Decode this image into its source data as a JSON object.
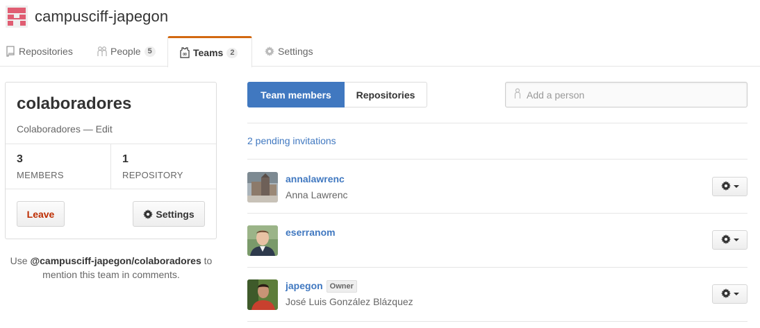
{
  "org": {
    "name": "campusciff-japegon",
    "avatar_icon": "identicon",
    "avatar_color": "#e05d72"
  },
  "tabs": [
    {
      "label": "Repositories",
      "icon": "repo-icon",
      "count": ""
    },
    {
      "label": "People",
      "icon": "people-icon",
      "count": "5"
    },
    {
      "label": "Teams",
      "icon": "jersey-icon",
      "count": "2"
    },
    {
      "label": "Settings",
      "icon": "gear-icon",
      "count": ""
    }
  ],
  "team": {
    "name": "colaboradores",
    "description": "Colaboradores",
    "separator": " — ",
    "edit_label": "Edit",
    "members_count": "3",
    "members_label": "MEMBERS",
    "repos_count": "1",
    "repos_label": "REPOSITORY",
    "leave_label": "Leave",
    "settings_label": "Settings",
    "mention_prefix": "Use ",
    "mention_handle": "@campusciff-japegon/colaboradores",
    "mention_suffix": " to mention this team in comments."
  },
  "panel": {
    "tab_members": "Team members",
    "tab_repos": "Repositories",
    "add_placeholder": "Add a person",
    "pending": "2 pending invitations"
  },
  "members": [
    {
      "login": "annalawrenc",
      "name": "Anna Lawrenc",
      "badge": ""
    },
    {
      "login": "eserranom",
      "name": "",
      "badge": ""
    },
    {
      "login": "japegon",
      "name": "José Luis González Blázquez",
      "badge": "Owner"
    }
  ],
  "colors": {
    "link": "#4078c0",
    "accent_tab": "#d26911",
    "danger": "#bd2c00"
  }
}
